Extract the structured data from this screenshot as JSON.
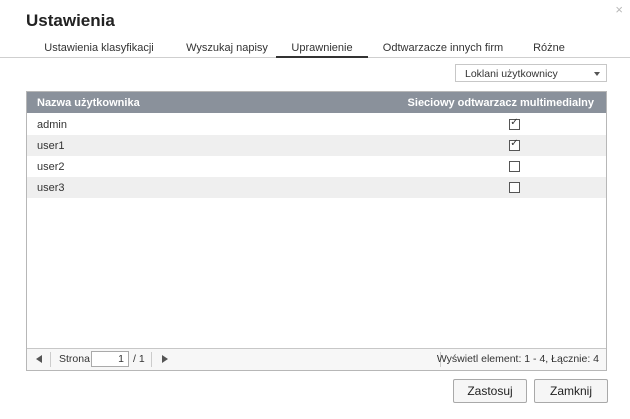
{
  "dialog": {
    "title": "Ustawienia",
    "close_glyph": "×",
    "close_icon": "close-icon"
  },
  "tabs": [
    {
      "label": "Ustawienia klasyfikacji",
      "active": false
    },
    {
      "label": "Wyszukaj napisy",
      "active": false
    },
    {
      "label": "Uprawnienie",
      "active": true
    },
    {
      "label": "Odtwarzacze innych firm",
      "active": false
    },
    {
      "label": "Różne",
      "active": false
    }
  ],
  "filter": {
    "selected": "Loklani użytkownicy",
    "icon": "chevron-down-icon"
  },
  "grid": {
    "columns": {
      "user": "Nazwa użytkownika",
      "media": "Sieciowy odtwarzacz multimedialny"
    },
    "rows": [
      {
        "user": "admin",
        "media_player": true
      },
      {
        "user": "user1",
        "media_player": true
      },
      {
        "user": "user2",
        "media_player": false
      },
      {
        "user": "user3",
        "media_player": false
      }
    ]
  },
  "pager": {
    "page_label": "Strona",
    "page_value": "1",
    "page_total": "/ 1",
    "info": "Wyświetl element: 1 - 4, Łącznie: 4",
    "prev_icon": "previous-page-icon",
    "next_icon": "next-page-icon"
  },
  "buttons": {
    "apply": "Zastosuj",
    "close": "Zamknij"
  },
  "colors": {
    "header_bg": "#8a919b",
    "row_alt": "#efefef",
    "border": "#b7b7b7"
  }
}
